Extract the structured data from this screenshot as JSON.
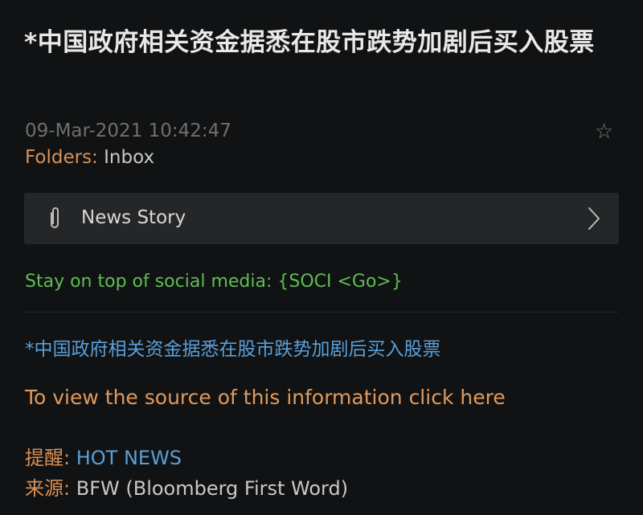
{
  "headline": "*中国政府相关资金据悉在股市跌势加剧后买入股票",
  "timestamp": "09-Mar-2021 10:42:47",
  "star_glyph": "☆",
  "folders": {
    "label": "Folders:",
    "value": "Inbox"
  },
  "attachment": {
    "icon": "paperclip-icon",
    "label": "News Story",
    "chevron_icon": "chevron-right-icon"
  },
  "social_text": "Stay on top of social media: {SOCI <Go>}",
  "related_link": "*中国政府相关资金据悉在股市跌势加剧后买入股票",
  "source_link": "To view the source of this information click here",
  "meta": {
    "reminder_key": "提醒:",
    "reminder_value": "HOT NEWS",
    "source_key": "来源:",
    "source_value": "BFW (Bloomberg First Word)"
  },
  "colors": {
    "background": "#111213",
    "title": "#e8e8e8",
    "timestamp": "#6f6f6f",
    "orange_label": "#d99056",
    "green_link": "#5fbd55",
    "blue_link": "#5a9fd8",
    "source_link": "#e09a5d",
    "box_bg": "#252627"
  }
}
